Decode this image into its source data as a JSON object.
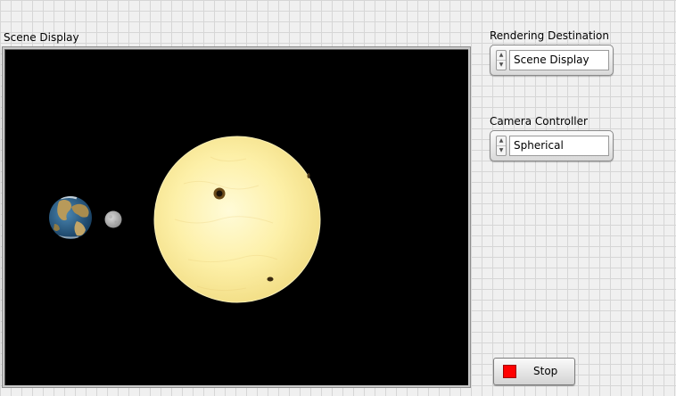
{
  "scene": {
    "label": "Scene Display",
    "background_color": "#000000",
    "objects": [
      {
        "name": "earth",
        "depiction": "planet-earth"
      },
      {
        "name": "moon",
        "depiction": "gray-moon"
      },
      {
        "name": "sun",
        "depiction": "yellow-sun-with-sunspots"
      }
    ]
  },
  "rendering_destination": {
    "label": "Rendering Destination",
    "value": "Scene Display"
  },
  "camera_controller": {
    "label": "Camera Controller",
    "value": "Spherical"
  },
  "stop": {
    "label": "Stop",
    "led_color": "#ff0000"
  },
  "icons": {
    "spin_up": "spin-up-arrow-icon",
    "spin_down": "spin-down-arrow-icon"
  }
}
